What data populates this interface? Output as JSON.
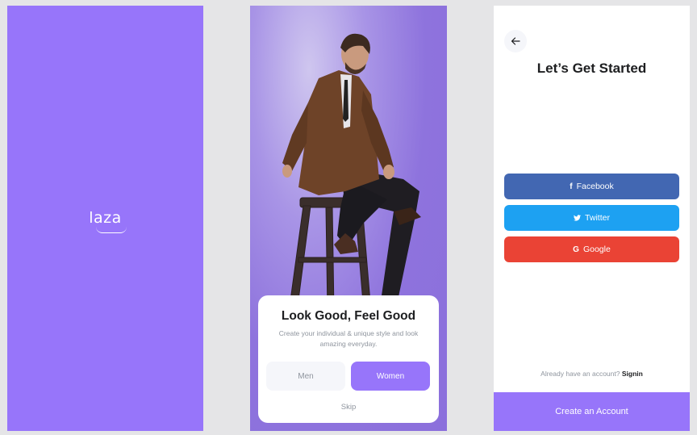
{
  "splash": {
    "logo": "laza"
  },
  "onboarding": {
    "title": "Look Good, Feel Good",
    "subtitle": "Create your individual & unique style and look amazing everyday.",
    "men_label": "Men",
    "women_label": "Women",
    "skip_label": "Skip"
  },
  "get_started": {
    "title": "Let’s Get Started",
    "facebook_label": "Facebook",
    "twitter_label": "Twitter",
    "google_label": "Google",
    "have_account": "Already have an account?",
    "signin_label": "Signin",
    "create_label": "Create an Account"
  },
  "colors": {
    "accent": "#9775fa",
    "facebook": "#4267b2",
    "twitter": "#1da1f2",
    "google": "#ea4335"
  },
  "icons": [
    "arrow-left-icon",
    "facebook-icon",
    "twitter-icon",
    "google-icon"
  ]
}
